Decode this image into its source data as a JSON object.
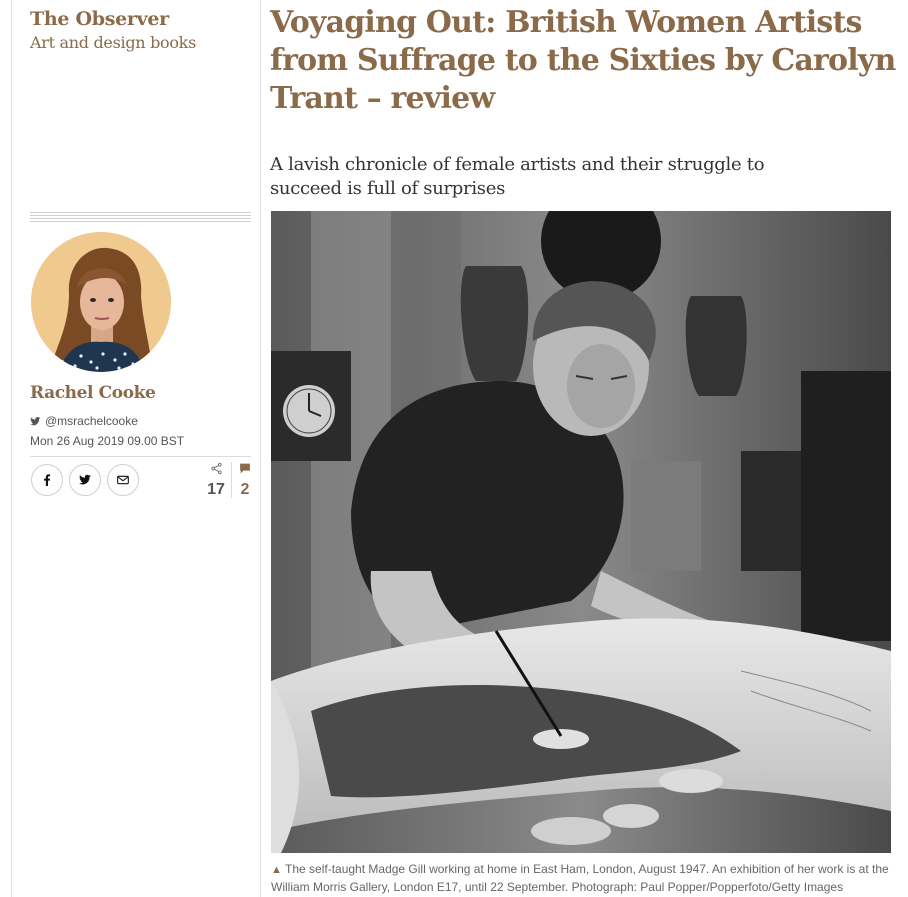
{
  "publication": "The Observer",
  "section": "Art and design books",
  "headline": "Voyaging Out: British Women Artists from Suffrage to the Sixties by Carolyn Trant – review",
  "standfirst": "A lavish chronicle of female artists and their struggle to succeed is full of surprises",
  "author": {
    "name": "Rachel Cooke",
    "twitter": "@msrachelcooke",
    "date": "Mon 26 Aug 2019 09.00 BST"
  },
  "share": {
    "icons": [
      "facebook-icon",
      "twitter-icon",
      "email-icon"
    ],
    "shares_count": "17",
    "comments_count": "2"
  },
  "image": {
    "caption": "The self-taught Madge Gill working at home in East Ham, London, August 1947. An exhibition of her work is at the William Morris Gallery, London E17, until 22 September. Photograph: Paul Popper/Popperfoto/Getty Images"
  },
  "colors": {
    "accent": "#8b6a4a",
    "avatar_bg": "#f0c98f"
  }
}
